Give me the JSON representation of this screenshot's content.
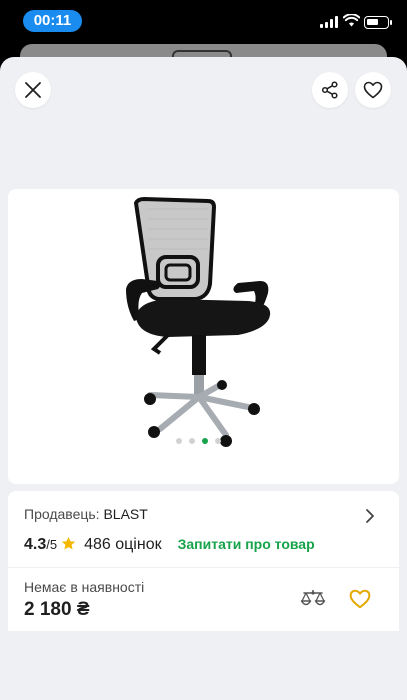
{
  "status_bar": {
    "time": "00:11",
    "battery_level": 0.6
  },
  "header": {
    "close_icon": "close-icon",
    "share_icon": "share-icon",
    "favorite_icon": "heart-icon"
  },
  "gallery": {
    "image_alt": "office chair",
    "dots_count": 4,
    "active_dot": 2
  },
  "seller": {
    "label": "Продавець:",
    "name": "BLAST"
  },
  "rating": {
    "value": "4.3",
    "max": "/5",
    "reviews": "486 оцінок",
    "ask_link": "Запитати про товар"
  },
  "offer": {
    "availability": "Немає в наявності",
    "price": "2 180 ₴",
    "compare_icon": "scales-icon",
    "wishlist_icon": "heart-outline-icon"
  },
  "colors": {
    "accent_green": "#17a34a",
    "star_yellow": "#f5b800",
    "time_pill": "#1a8cf0"
  }
}
